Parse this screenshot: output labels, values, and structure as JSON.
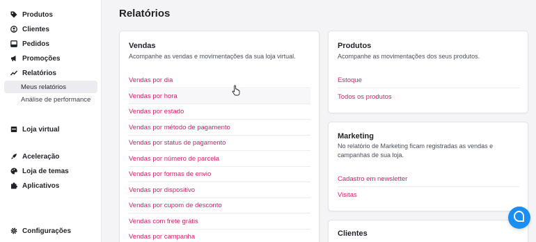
{
  "sidebar": {
    "items": [
      {
        "label": "Produtos",
        "icon": "tag-icon"
      },
      {
        "label": "Clientes",
        "icon": "user-circle-icon"
      },
      {
        "label": "Pedidos",
        "icon": "inbox-icon"
      },
      {
        "label": "Promoções",
        "icon": "megaphone-icon"
      },
      {
        "label": "Relatórios",
        "icon": "chart-line-icon"
      }
    ],
    "subitems": [
      {
        "label": "Meus relatórios",
        "active": true
      },
      {
        "label": "Análise de performance",
        "active": false
      }
    ],
    "store": {
      "label": "Loja virtual",
      "icon": "store-icon"
    },
    "extras": [
      {
        "label": "Aceleração",
        "icon": "rocket-icon"
      },
      {
        "label": "Loja de temas",
        "icon": "palette-icon"
      },
      {
        "label": "Aplicativos",
        "icon": "puzzle-icon"
      }
    ],
    "settings": {
      "label": "Configurações",
      "icon": "gear-icon"
    }
  },
  "page": {
    "title": "Relatórios"
  },
  "cards": {
    "vendas": {
      "title": "Vendas",
      "description": "Acompanhe as vendas e movimentações da sua loja virtual.",
      "links": [
        "Vendas por dia",
        "Vendas por hora",
        "Vendas por estado",
        "Vendas por método de pagamento",
        "Vendas por status de pagamento",
        "Vendas por número de parcela",
        "Vendas por formas de envio",
        "Vendas por dispositivo",
        "Vendas por cupom de desconto",
        "Vendas com frete grátis",
        "Vendas por campanha"
      ]
    },
    "produtos": {
      "title": "Produtos",
      "description": "Acompanhe as movimentações dos seus produtos.",
      "links": [
        "Estoque",
        "Todos os produtos"
      ]
    },
    "marketing": {
      "title": "Marketing",
      "description": "No relatório de Marketing ficam registradas as vendas e campanhas de sua loja.",
      "links": [
        "Cadastro em newsletter",
        "Visitas"
      ]
    },
    "clientes": {
      "title": "Clientes"
    }
  },
  "colors": {
    "accent": "#d11f6b",
    "chat": "#1a8ff2"
  }
}
